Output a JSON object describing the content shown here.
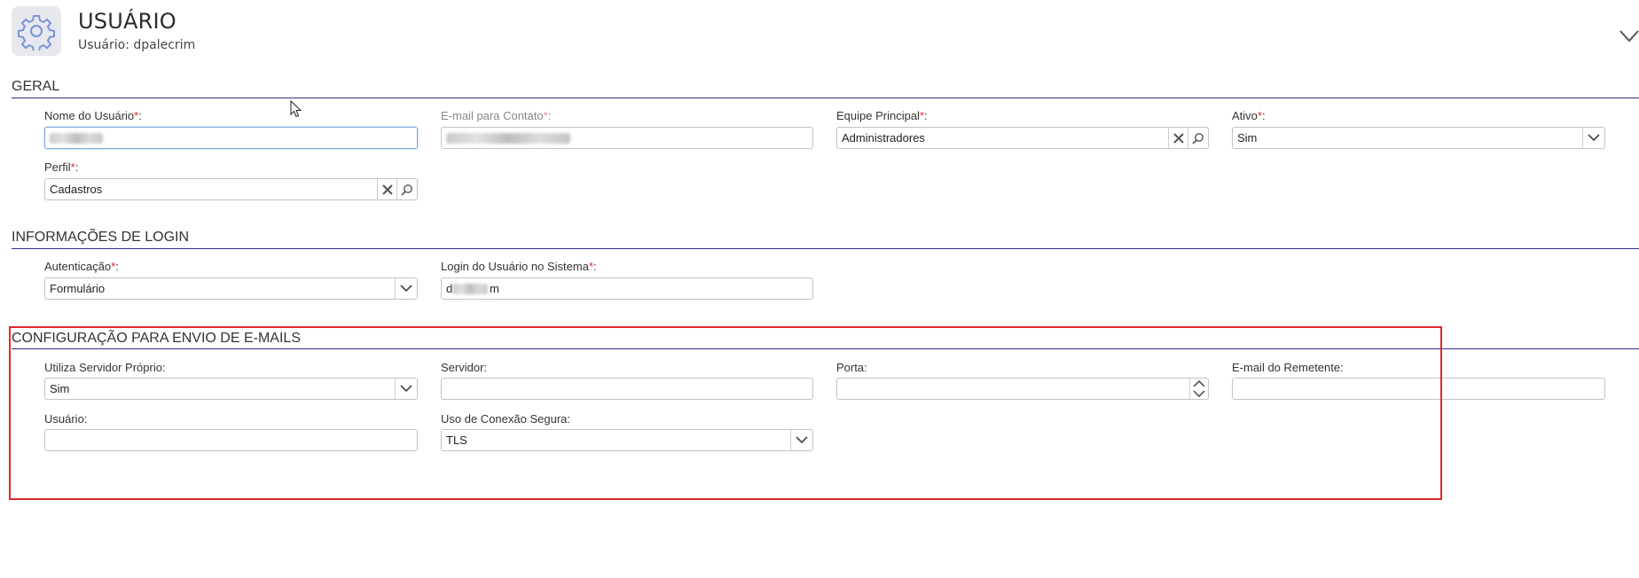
{
  "header": {
    "icon": "gear-icon",
    "title": "USUÁRIO",
    "subtitle": "Usuário: dpalecrim"
  },
  "colors": {
    "required": "#e3262d",
    "section_line": "#2c2c8c",
    "highlight": "#e3262d"
  },
  "sections": {
    "geral": {
      "title": "GERAL",
      "nome_usuario": {
        "label": "Nome do Usuário",
        "required_mark": "*",
        "suffix": ":"
      },
      "email_contato": {
        "label": "E-mail para Contato",
        "required_mark": "*",
        "suffix": ":"
      },
      "equipe_principal": {
        "label": "Equipe Principal",
        "required_mark": "*",
        "suffix": ":",
        "value": "Administradores"
      },
      "ativo": {
        "label": "Ativo",
        "required_mark": "*",
        "suffix": ":",
        "value": "Sim"
      },
      "perfil": {
        "label": "Perfil",
        "required_mark": "*",
        "suffix": ":",
        "value": "Cadastros"
      }
    },
    "login": {
      "title": "INFORMAÇÕES DE LOGIN",
      "autenticacao": {
        "label": "Autenticação",
        "required_mark": "*",
        "suffix": ":",
        "value": "Formulário"
      },
      "login_sistema": {
        "label": "Login do Usuário no Sistema",
        "required_mark": "*",
        "suffix": ":",
        "value_visible_start": "d",
        "value_visible_end": "m"
      }
    },
    "email_config": {
      "title": "CONFIGURAÇÃO PARA ENVIO DE E-MAILS",
      "servidor_proprio": {
        "label": "Utiliza Servidor Próprio:",
        "value": "Sim"
      },
      "servidor": {
        "label": "Servidor:",
        "value": ""
      },
      "porta": {
        "label": "Porta:",
        "value": ""
      },
      "email_remetente": {
        "label": "E-mail do Remetente:",
        "value": ""
      },
      "usuario": {
        "label": "Usuário:",
        "value": ""
      },
      "conexao_segura": {
        "label": "Uso de Conexão Segura:",
        "value": "TLS"
      }
    }
  }
}
